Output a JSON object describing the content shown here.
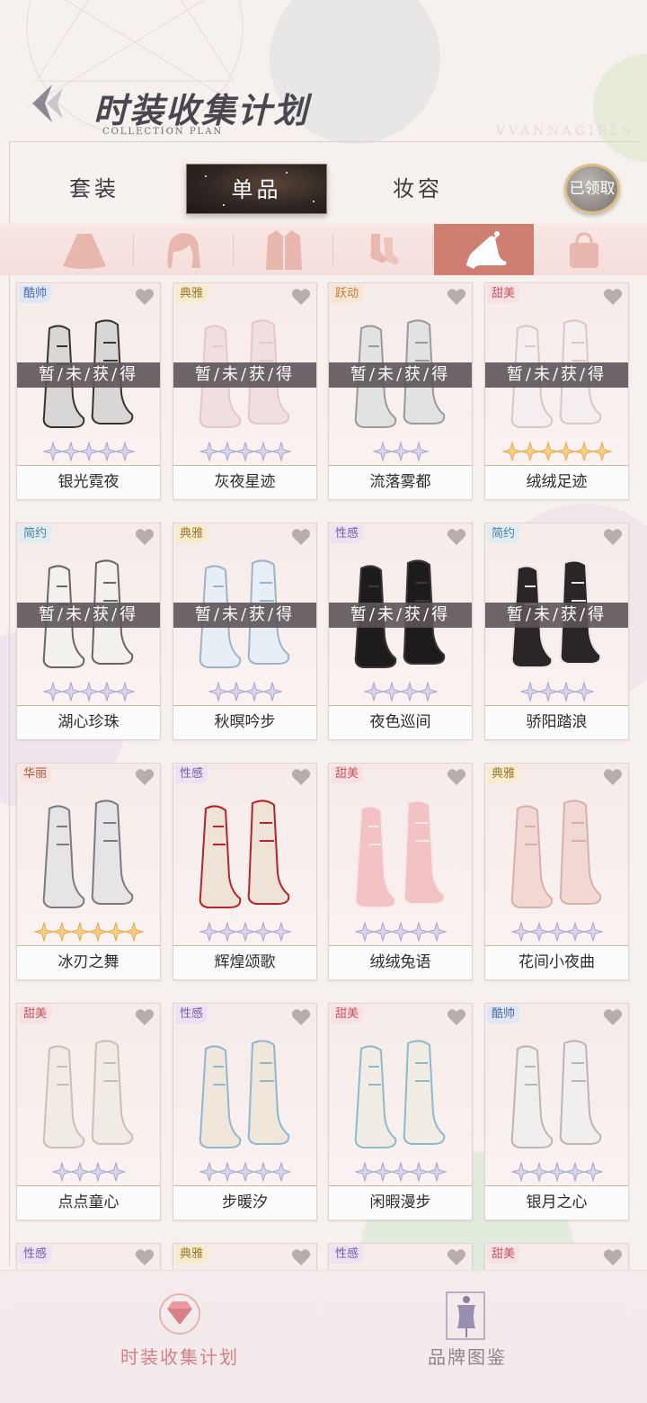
{
  "header": {
    "title": "时装收集计划",
    "subtitle": "COLLECTION PLAN",
    "brand_watermark": "VVANNAGIRLS"
  },
  "tabs": [
    {
      "label": "套装",
      "active": false
    },
    {
      "label": "单品",
      "active": true
    },
    {
      "label": "妆容",
      "active": false
    }
  ],
  "claim_button": "已领取",
  "categories": [
    {
      "icon": "skirt-icon",
      "active": false
    },
    {
      "icon": "hair-icon",
      "active": false
    },
    {
      "icon": "coat-icon",
      "active": false
    },
    {
      "icon": "socks-icon",
      "active": false
    },
    {
      "icon": "high-heel-icon",
      "active": true
    },
    {
      "icon": "handbag-icon",
      "active": false
    }
  ],
  "not_obtained_label": "暂/未/获/得",
  "items": [
    {
      "tag": "酷帅",
      "tag_style": "cool",
      "name": "银光霓夜",
      "stars": 5,
      "star_color": "silver",
      "obtained": false,
      "shoe": "lace-up-boots"
    },
    {
      "tag": "典雅",
      "tag_style": "elegant",
      "name": "灰夜星迹",
      "stars": 5,
      "star_color": "silver",
      "obtained": false,
      "shoe": "pink-pumps"
    },
    {
      "tag": "跃动",
      "tag_style": "lively",
      "name": "流落雾都",
      "stars": 3,
      "star_color": "silver",
      "obtained": false,
      "shoe": "sneakers"
    },
    {
      "tag": "甜美",
      "tag_style": "sweet",
      "name": "绒绒足迹",
      "stars": 6,
      "star_color": "gold",
      "obtained": false,
      "shoe": "fluffy-heels"
    },
    {
      "tag": "简约",
      "tag_style": "simple",
      "name": "湖心珍珠",
      "stars": 5,
      "star_color": "silver",
      "obtained": false,
      "shoe": "mary-janes"
    },
    {
      "tag": "典雅",
      "tag_style": "elegant",
      "name": "秋暝吟步",
      "stars": 4,
      "star_color": "silver",
      "obtained": false,
      "shoe": "strappy-sandals"
    },
    {
      "tag": "性感",
      "tag_style": "sexy",
      "name": "夜色巡间",
      "stars": 4,
      "star_color": "silver",
      "obtained": false,
      "shoe": "black-slingbacks"
    },
    {
      "tag": "简约",
      "tag_style": "simple",
      "name": "骄阳踏浪",
      "stars": 4,
      "star_color": "silver",
      "obtained": false,
      "shoe": "black-sandals"
    },
    {
      "tag": "华丽",
      "tag_style": "gorgeous",
      "name": "冰刃之舞",
      "stars": 6,
      "star_color": "gold",
      "obtained": true,
      "shoe": "ice-skates"
    },
    {
      "tag": "性感",
      "tag_style": "sexy",
      "name": "辉煌颂歌",
      "stars": 5,
      "star_color": "silver",
      "obtained": true,
      "shoe": "jeweled-boots"
    },
    {
      "tag": "甜美",
      "tag_style": "sweet",
      "name": "绒绒兔语",
      "stars": 5,
      "star_color": "silver",
      "obtained": true,
      "shoe": "bunny-slippers"
    },
    {
      "tag": "典雅",
      "tag_style": "elegant",
      "name": "花间小夜曲",
      "stars": 5,
      "star_color": "silver",
      "obtained": true,
      "shoe": "platform-heels"
    },
    {
      "tag": "甜美",
      "tag_style": "sweet",
      "name": "点点童心",
      "stars": 4,
      "star_color": "silver",
      "obtained": true,
      "shoe": "bow-heels"
    },
    {
      "tag": "性感",
      "tag_style": "sexy",
      "name": "步暖汐",
      "stars": 5,
      "star_color": "silver",
      "obtained": true,
      "shoe": "clear-pumps"
    },
    {
      "tag": "甜美",
      "tag_style": "sweet",
      "name": "闲暇漫步",
      "stars": 5,
      "star_color": "silver",
      "obtained": true,
      "shoe": "ankle-boots"
    },
    {
      "tag": "酷帅",
      "tag_style": "cool",
      "name": "银月之心",
      "stars": 5,
      "star_color": "silver",
      "obtained": true,
      "shoe": "white-lace-boots"
    },
    {
      "tag": "性感",
      "tag_style": "sexy",
      "name": "",
      "stars": 0,
      "star_color": "silver",
      "obtained": true,
      "shoe": ""
    },
    {
      "tag": "典雅",
      "tag_style": "elegant",
      "name": "",
      "stars": 0,
      "star_color": "silver",
      "obtained": true,
      "shoe": ""
    },
    {
      "tag": "性感",
      "tag_style": "sexy",
      "name": "",
      "stars": 0,
      "star_color": "silver",
      "obtained": true,
      "shoe": ""
    },
    {
      "tag": "甜美",
      "tag_style": "sweet",
      "name": "",
      "stars": 0,
      "star_color": "silver",
      "obtained": true,
      "shoe": ""
    }
  ],
  "bottom_nav": [
    {
      "label": "时装收集计划",
      "icon": "diamond-icon",
      "active": true
    },
    {
      "label": "品牌图鉴",
      "icon": "mannequin-icon",
      "active": false
    }
  ]
}
